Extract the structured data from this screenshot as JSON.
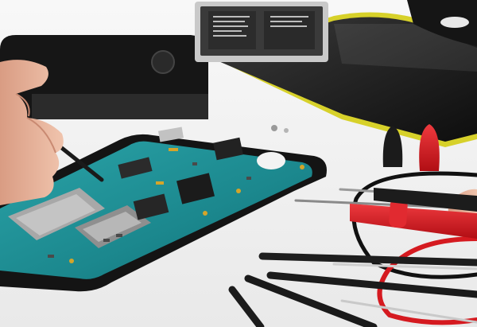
{
  "scene": {
    "subject": "smartphone-repair",
    "colors": {
      "background": "#f4f4f4",
      "circuit_board": "#1f8f95",
      "phone_body": "#141414",
      "yellow_trim": "#d7d12a",
      "probe_red": "#d51a20",
      "tool_black": "#1b1b1b",
      "skin": "#e7b39a",
      "battery_label": "#3a3a3a"
    }
  }
}
